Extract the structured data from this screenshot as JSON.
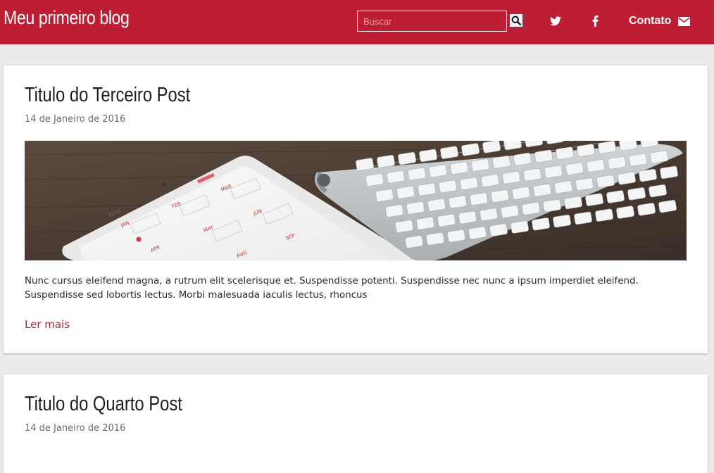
{
  "header": {
    "brand": "Meu primeiro blog",
    "search_placeholder": "Buscar",
    "search_icon": "search-icon",
    "social_icons": [
      "twitter-icon",
      "facebook-icon"
    ],
    "contact_label": "Contato",
    "contact_icon": "envelope-icon",
    "background": "#be1e33"
  },
  "posts": [
    {
      "title": "Titulo do Terceiro Post",
      "date": "14 de Janeiro de 2016",
      "image": "tablet-calendar-and-keyboard-photo",
      "image_months": [
        "JAN",
        "FEB",
        "MAR",
        "APR",
        "MAY",
        "JUN",
        "AUG",
        "SEP"
      ],
      "image_year": "2015",
      "excerpt": "Nunc cursus eleifend magna, a rutrum elit scelerisque et. Suspendisse potenti. Suspendisse nec nunc a ipsum imperdiet eleifend. Suspendisse sed lobortis lectus. Morbi malesuada iaculis lectus, rhoncus",
      "read_more": "Ler mais"
    },
    {
      "title": "Titulo do Quarto Post",
      "date": "14 de Janeiro de 2016"
    }
  ],
  "colors": {
    "accent": "#be1e33",
    "link": "#b0263a",
    "page_background": "#ebebeb"
  }
}
